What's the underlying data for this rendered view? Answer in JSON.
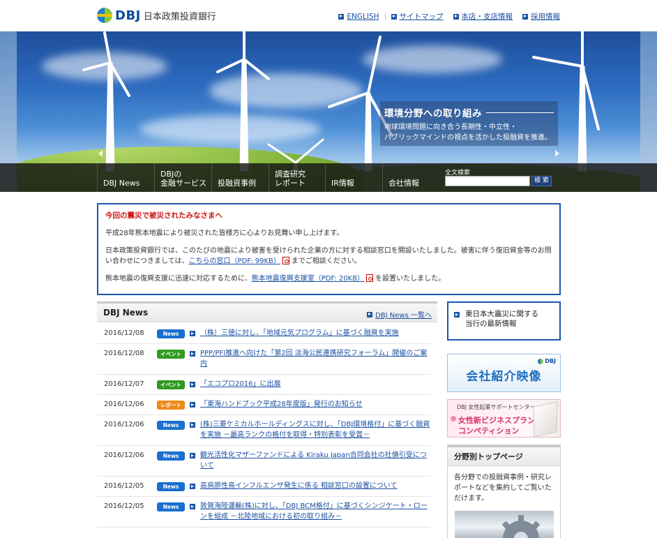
{
  "header": {
    "logo_text": "DBJ",
    "logo_subtitle": "日本政策投資銀行",
    "links": [
      "ENGLISH",
      "サイトマップ",
      "本店・支店情報",
      "採用情報"
    ]
  },
  "hero": {
    "caption_title": "環境分野への取り組み",
    "caption_line1": "地球環境問題に向き合う長期性・中立性・",
    "caption_line2": "パブリックマインドの視点を活かした投融資を推進。"
  },
  "nav": {
    "items": [
      {
        "line1": "DBJ News",
        "line2": ""
      },
      {
        "line1": "DBJの",
        "line2": "金融サービス"
      },
      {
        "line1": "投融資事例",
        "line2": ""
      },
      {
        "line1": "調査研究",
        "line2": "レポート"
      },
      {
        "line1": "IR情報",
        "line2": ""
      },
      {
        "line1": "会社情報",
        "line2": ""
      }
    ],
    "search_label": "全文検索",
    "search_value": "",
    "search_button": "検 索"
  },
  "notice": {
    "title": "今回の震災で被災されたみなさまへ",
    "p1": "平成28年熊本地震により被災された皆様方に心よりお見舞い申し上げます。",
    "p2_a": "日本政策投資銀行では、このたびの地震により被害を受けられた企業の方に対する相談窓口を開設いたしました。被害に伴う復旧資金等のお問い合わせにつきましては、",
    "p2_link": "こちらの窓口（PDF: 99KB）",
    "p2_b": "までご相談ください。",
    "p3_a": "熊本地震の復興支援に迅速に対応するために、",
    "p3_link": "熊本地震復興支援室（PDF: 20KB）",
    "p3_b": "を設置いたしました。"
  },
  "news": {
    "title": "DBJ News",
    "more": "DBJ News 一覧へ",
    "items": [
      {
        "date": "2016/12/08",
        "badge": "News",
        "type": "news",
        "text": "（株）三徳に対し、「地域元気プログラム」に基づく融資を実施"
      },
      {
        "date": "2016/12/08",
        "badge": "イベント",
        "type": "event",
        "text": "PPP/PFI推進へ向けた「第2回 淡海公民連携研究フォーラム」開催のご案内"
      },
      {
        "date": "2016/12/07",
        "badge": "イベント",
        "type": "event",
        "text": "「エコプロ2016」に出展"
      },
      {
        "date": "2016/12/06",
        "badge": "レポート",
        "type": "report",
        "text": "「東海ハンドブック平成28年度版」発行のお知らせ"
      },
      {
        "date": "2016/12/06",
        "badge": "News",
        "type": "news",
        "text": "(株)三菱ケミカルホールディングスに対し、「DBJ環境格付」に基づく融資を実施 －最高ランクの格付を取得・特別表彰を受賞－"
      },
      {
        "date": "2016/12/06",
        "badge": "News",
        "type": "news",
        "text": "観光活性化マザーファンドによる Kiraku Japan合同会社の社債引受について"
      },
      {
        "date": "2016/12/05",
        "badge": "News",
        "type": "news",
        "text": "高病原性鳥インフルエンザ発生に係る 相談窓口の設置について"
      },
      {
        "date": "2016/12/05",
        "badge": "News",
        "type": "news",
        "text": "敦賀海陸運輸(株)に対し、「DBJ BCM格付」に基づくシンジケート・ローンを組成 －北陸地域における初の取り組み－"
      }
    ]
  },
  "side": {
    "box1_line1": "東日本大震災に関する",
    "box1_line2": "当行の最新情報",
    "video_logo": "DBJ",
    "video_text": "会社紹介映像",
    "women_top": "DBJ 女性起業サポートセンター",
    "women_line1": "女性新ビジネスプラン",
    "women_line2": "コンペティション",
    "box2_title": "分野別トップページ",
    "box2_text": "各分野での投融資事例・研究レポートなどを集約してご覧いただけます。"
  },
  "colors": {
    "accent_blue": "#1a56a8",
    "link": "#1a4fa0",
    "notice_red": "#d01010",
    "badge_news": "#1a6fd0",
    "badge_event": "#2f9a1f",
    "badge_report": "#f08a17"
  }
}
